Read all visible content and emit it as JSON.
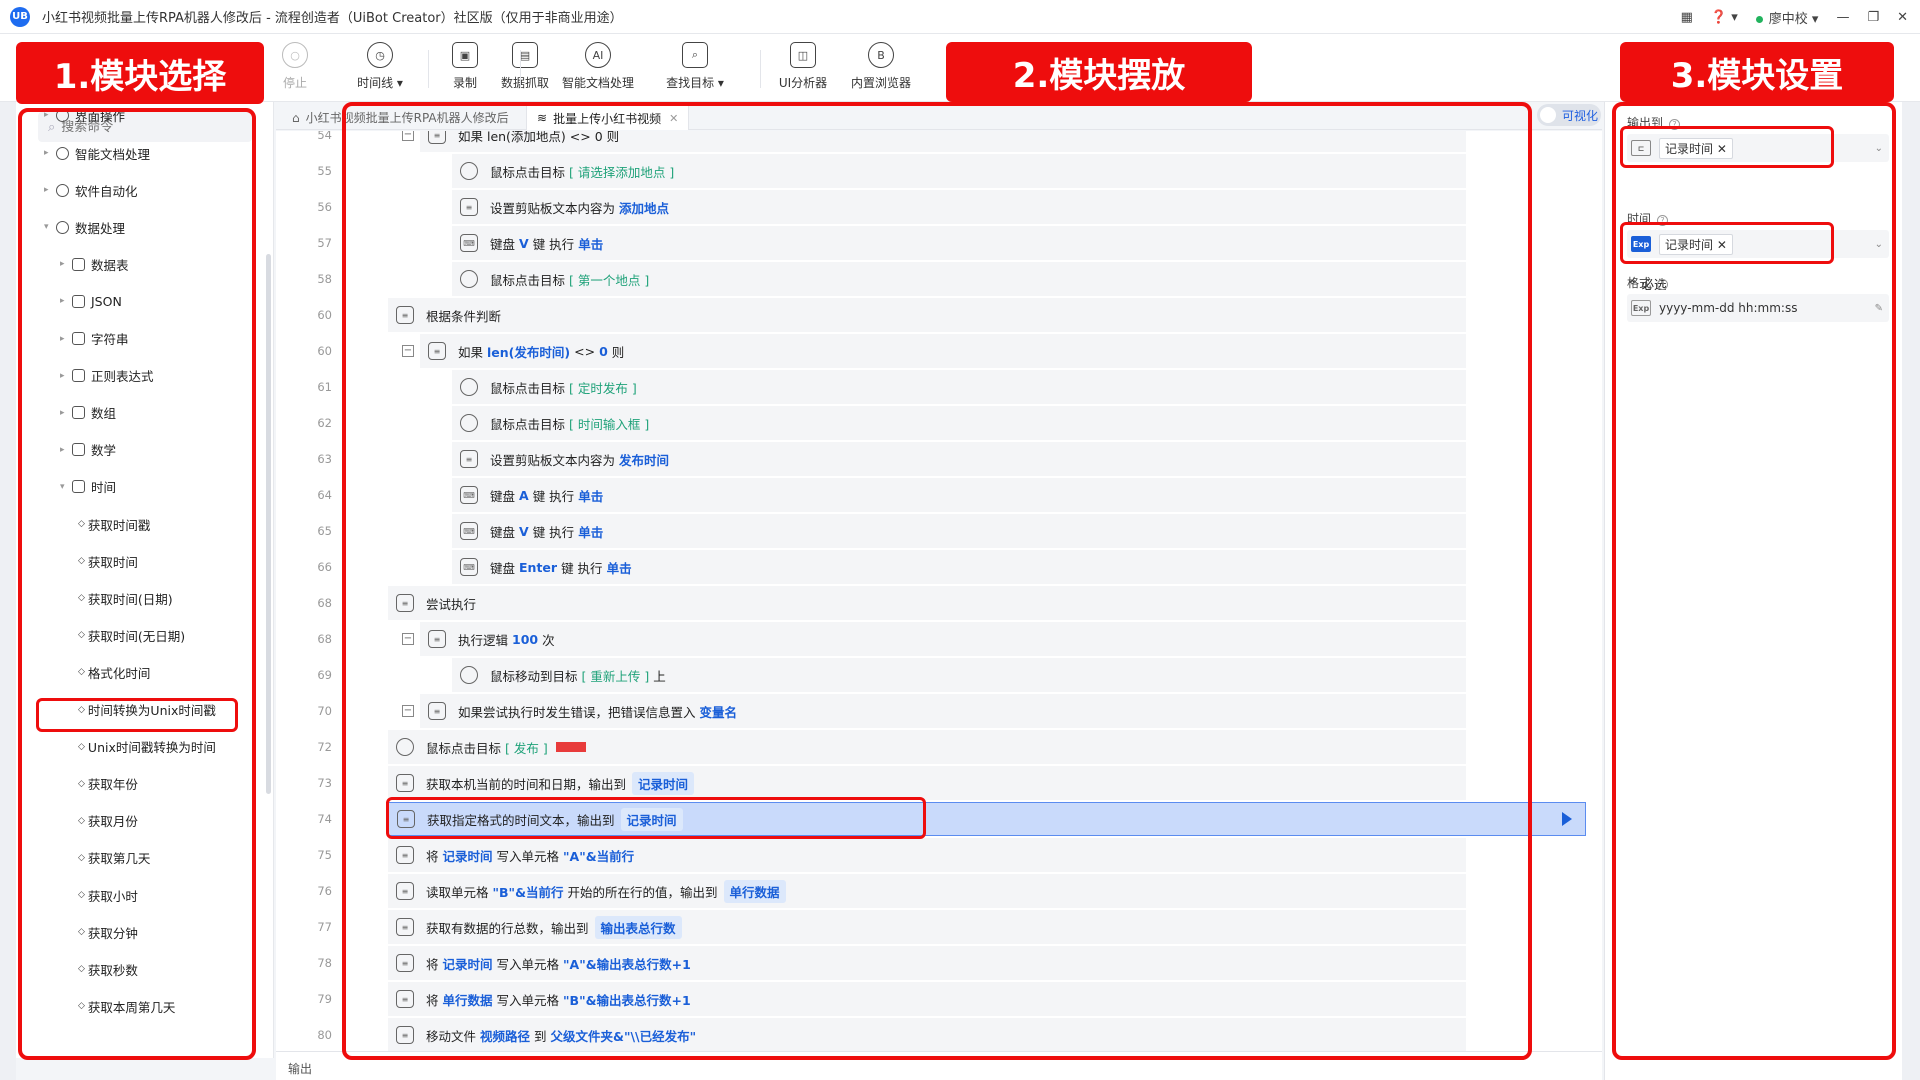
{
  "window": {
    "title": "小红书视频批量上传RPA机器人修改后 - 流程创造者（UiBot Creator）社区版（仅用于非商业用途）",
    "logo_text": "UB",
    "user": "廖中校"
  },
  "toolbar": [
    {
      "label": "停止",
      "icon": "stop-icon",
      "glyph": "○"
    },
    {
      "label": "时间线 ▾",
      "icon": "clock-icon",
      "glyph": "◷"
    },
    {
      "label": "录制",
      "icon": "record-icon",
      "glyph": "▣"
    },
    {
      "label": "数据抓取",
      "icon": "data-scrape-icon",
      "glyph": "▤"
    },
    {
      "label": "智能文档处理",
      "icon": "ai-doc-icon",
      "glyph": "AI"
    },
    {
      "label": "查找目标 ▾",
      "icon": "find-target-icon",
      "glyph": "⌕"
    },
    {
      "label": "UI分析器",
      "icon": "ui-analyzer-icon",
      "glyph": "◫"
    },
    {
      "label": "内置浏览器",
      "icon": "browser-icon",
      "glyph": "B"
    }
  ],
  "search": {
    "placeholder": "搜索命令"
  },
  "tree": [
    {
      "label": "界面操作",
      "level": 0
    },
    {
      "label": "智能文档处理",
      "level": 0
    },
    {
      "label": "软件自动化",
      "level": 0
    },
    {
      "label": "数据处理",
      "level": 0
    },
    {
      "label": "数据表",
      "level": 1
    },
    {
      "label": "JSON",
      "level": 1
    },
    {
      "label": "字符串",
      "level": 1
    },
    {
      "label": "正则表达式",
      "level": 1
    },
    {
      "label": "数组",
      "level": 1
    },
    {
      "label": "数学",
      "level": 1
    },
    {
      "label": "时间",
      "level": 1
    },
    {
      "label": "获取时间戳",
      "level": 2
    },
    {
      "label": "获取时间",
      "level": 2
    },
    {
      "label": "获取时间(日期)",
      "level": 2
    },
    {
      "label": "获取时间(无日期)",
      "level": 2
    },
    {
      "label": "格式化时间",
      "level": 2
    },
    {
      "label": "时间转换为Unix时间戳",
      "level": 2
    },
    {
      "label": "Unix时间戳转换为时间",
      "level": 2
    },
    {
      "label": "获取年份",
      "level": 2
    },
    {
      "label": "获取月份",
      "level": 2
    },
    {
      "label": "获取第几天",
      "level": 2
    },
    {
      "label": "获取小时",
      "level": 2
    },
    {
      "label": "获取分钟",
      "level": 2
    },
    {
      "label": "获取秒数",
      "level": 2
    },
    {
      "label": "获取本周第几天",
      "level": 2
    }
  ],
  "tabs": [
    {
      "label": "小红书视频批量上传RPA机器人修改后"
    },
    {
      "label": "批量上传小红书视频"
    }
  ],
  "visual_toggle": "可视化",
  "flow": [
    {
      "line": "54",
      "indent": 2,
      "text": "如果 len(添加地点) <> 0 则"
    },
    {
      "line": "55",
      "indent": 3,
      "pre": "鼠标点击目标",
      "target": "[ 请选择添加地点 ]"
    },
    {
      "line": "56",
      "indent": 3,
      "pre": "设置剪贴板文本内容为",
      "kw": "添加地点"
    },
    {
      "line": "57",
      "indent": 3,
      "pre": "键盘",
      "kw": "V",
      "mid": "键 执行",
      "kw2": "单击"
    },
    {
      "line": "58",
      "indent": 3,
      "pre": "鼠标点击目标",
      "target": "[ 第一个地点 ]"
    },
    {
      "line": "60",
      "indent": 1,
      "pre": "根据条件判断"
    },
    {
      "line": "60",
      "indent": 2,
      "pre": "如果",
      "kw": "len(发布时间)",
      "mid": "<>",
      "kw2": "0",
      "post": "则"
    },
    {
      "line": "61",
      "indent": 3,
      "pre": "鼠标点击目标",
      "target": "[ 定时发布 ]"
    },
    {
      "line": "62",
      "indent": 3,
      "pre": "鼠标点击目标",
      "target": "[ 时间输入框 ]"
    },
    {
      "line": "63",
      "indent": 3,
      "pre": "设置剪贴板文本内容为",
      "kw": "发布时间"
    },
    {
      "line": "64",
      "indent": 3,
      "pre": "键盘",
      "kw": "A",
      "mid": "键 执行",
      "kw2": "单击"
    },
    {
      "line": "65",
      "indent": 3,
      "pre": "键盘",
      "kw": "V",
      "mid": "键 执行",
      "kw2": "单击"
    },
    {
      "line": "66",
      "indent": 3,
      "pre": "键盘",
      "kw": "Enter",
      "mid": "键 执行",
      "kw2": "单击"
    },
    {
      "line": "68",
      "indent": 1,
      "pre": "尝试执行"
    },
    {
      "line": "68",
      "indent": 2,
      "pre": "执行逻辑",
      "kw": "100",
      "mid": "次"
    },
    {
      "line": "69",
      "indent": 3,
      "pre": "鼠标移动到目标",
      "target": "[ 重新上传 ]",
      "post": "上"
    },
    {
      "line": "70",
      "indent": 2,
      "pre": "如果尝试执行时发生错误，把错误信息置入",
      "kw": "变量名"
    },
    {
      "line": "72",
      "indent": 1,
      "pre": "鼠标点击目标",
      "target": "[ 发布 ]"
    },
    {
      "line": "73",
      "indent": 1,
      "pre": "获取本机当前的时间和日期，输出到",
      "chip": "记录时间"
    },
    {
      "line": "74",
      "indent": 1,
      "pre": "获取指定格式的时间文本，输出到",
      "chip": "记录时间",
      "selected": true
    },
    {
      "line": "75",
      "indent": 1,
      "pre": "将",
      "kw": "记录时间",
      "mid": "写入单元格",
      "kw2": "\"A\"&当前行"
    },
    {
      "line": "76",
      "indent": 1,
      "pre": "读取单元格",
      "kw": "\"B\"&当前行",
      "mid": "开始的所在行的值，输出到",
      "chip": "单行数据"
    },
    {
      "line": "77",
      "indent": 1,
      "pre": "获取有数据的行总数，输出到",
      "chip": "输出表总行数"
    },
    {
      "line": "78",
      "indent": 1,
      "pre": "将",
      "kw": "记录时间",
      "mid": "写入单元格",
      "kw2": "\"A\"&输出表总行数+1"
    },
    {
      "line": "79",
      "indent": 1,
      "pre": "将",
      "kw": "单行数据",
      "mid": "写入单元格",
      "kw2": "\"B\"&输出表总行数+1"
    },
    {
      "line": "80",
      "indent": 1,
      "pre": "移动文件",
      "kw": "视频路径",
      "mid": "到",
      "kw2": "父级文件夹&\"\\\\已经发布\""
    }
  ],
  "output_label": "输出",
  "props": {
    "output_label": "输出到",
    "output_value": "记录时间",
    "required_section": "必选",
    "time_label": "时间",
    "time_value": "记录时间",
    "format_label": "格式",
    "format_value": "yyyy-mm-dd hh:mm:ss",
    "exp_tag": "Exp"
  },
  "annotations": {
    "label1": "1.模块选择",
    "label2": "2.模块摆放",
    "label3": "3.模块设置"
  },
  "colors": {
    "accent": "#1a5fd8",
    "annotation_red": "#ee0d0d",
    "target_green": "#20a27a"
  }
}
